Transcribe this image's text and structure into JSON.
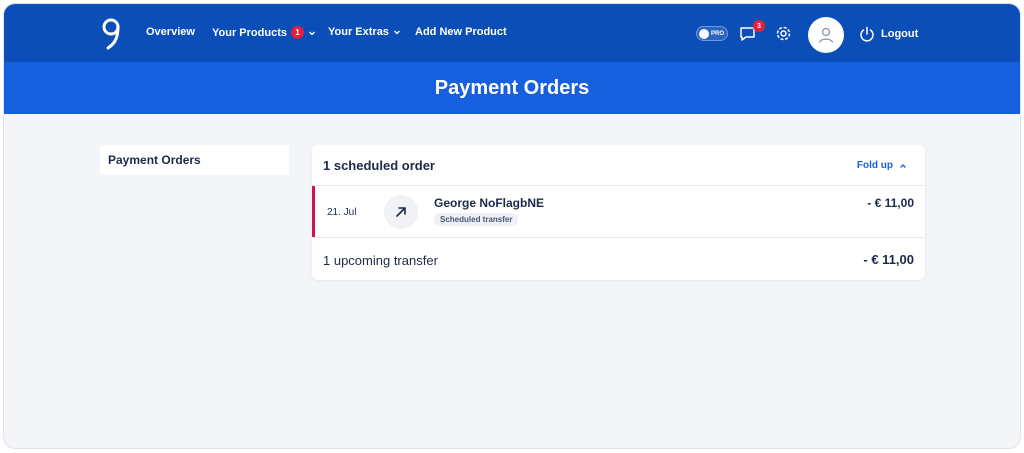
{
  "header": {
    "nav": [
      {
        "label": "Overview"
      },
      {
        "label": "Your Products",
        "badge": "1"
      },
      {
        "label": "Your Extras"
      },
      {
        "label": "Add New Product"
      }
    ],
    "pro_label": "PRO",
    "messages_badge": "3",
    "logout_label": "Logout",
    "icons": [
      "logo-icon",
      "chat-icon",
      "settings-icon",
      "user-avatar-icon",
      "power-icon"
    ]
  },
  "hero": {
    "title": "Payment Orders"
  },
  "sidebar": {
    "item": "Payment Orders"
  },
  "orders": {
    "title": "1 scheduled order",
    "fold_label": "Fold up",
    "row": {
      "date": "21. Jul",
      "name": "George NoFlagbNE",
      "tag": "Scheduled transfer",
      "amount": "- € 11,00",
      "icon": "arrow-up-right-icon"
    },
    "summary_label": "1 upcoming transfer",
    "summary_amount": "- € 11,00"
  },
  "colors": {
    "topbar": "#0b4eb8",
    "hero": "#1660e0",
    "accent": "#d1124f",
    "badge": "#e0213a"
  }
}
